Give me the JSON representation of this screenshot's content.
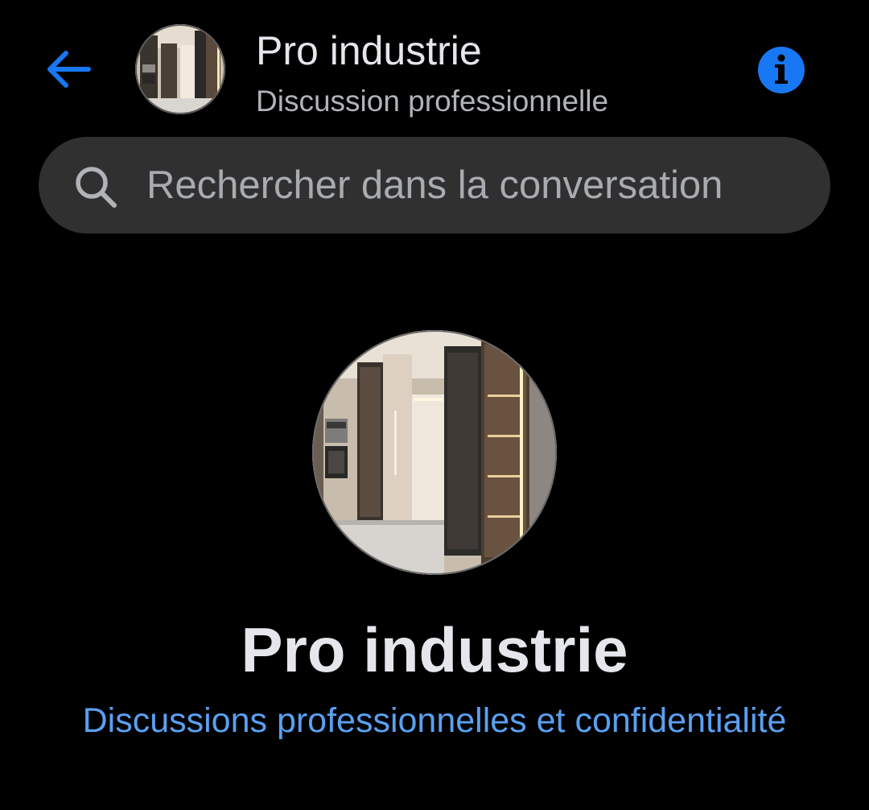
{
  "header": {
    "title": "Pro industrie",
    "subtitle": "Discussion professionnelle",
    "back_icon": "arrow-left-icon",
    "info_icon": "info-icon"
  },
  "search": {
    "placeholder": "Rechercher dans la conversation",
    "icon": "search-icon"
  },
  "profile": {
    "name": "Pro industrie",
    "privacy_link": "Discussions professionnelles et confidentialité"
  },
  "colors": {
    "background": "#000000",
    "accent": "#1877f2",
    "link": "#5aa0f0",
    "search_bg": "#303030",
    "primary_text": "#e4e6eb",
    "secondary_text": "#b0b3b8"
  }
}
